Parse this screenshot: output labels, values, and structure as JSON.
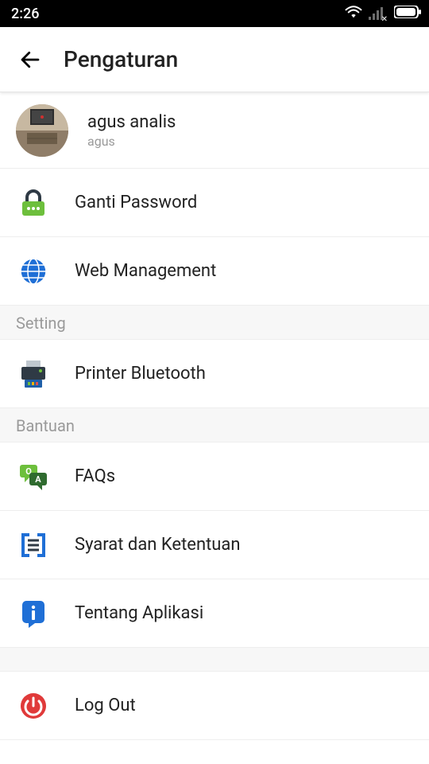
{
  "status": {
    "time": "2:26"
  },
  "header": {
    "title": "Pengaturan"
  },
  "profile": {
    "name": "agus analis",
    "sub": "agus"
  },
  "items": {
    "password": "Ganti Password",
    "web": "Web Management",
    "printer": "Printer Bluetooth",
    "faqs": "FAQs",
    "terms": "Syarat dan Ketentuan",
    "about": "Tentang Aplikasi",
    "logout": "Log Out"
  },
  "sections": {
    "setting": "Setting",
    "bantuan": "Bantuan"
  }
}
